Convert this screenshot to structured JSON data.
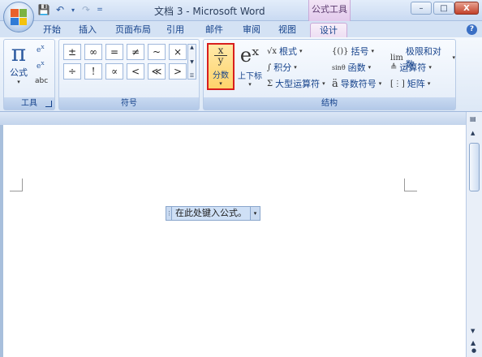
{
  "app": {
    "title": "文档 3 - Microsoft Word",
    "contextual_tab": "公式工具"
  },
  "window_controls": {
    "minimize": "–",
    "restore": "□",
    "close": "X"
  },
  "quick_access": {
    "save": "💾",
    "undo": "↶",
    "undo_arrow": "▾",
    "redo": "↷",
    "customize": "="
  },
  "tabs": [
    {
      "label": "开始"
    },
    {
      "label": "插入"
    },
    {
      "label": "页面布局"
    },
    {
      "label": "引用"
    },
    {
      "label": "邮件"
    },
    {
      "label": "审阅"
    },
    {
      "label": "视图"
    },
    {
      "label": "设计"
    }
  ],
  "help": "?",
  "ribbon": {
    "tools_group": {
      "label": "工具",
      "equation_label": "公式",
      "pi": "π",
      "abc": "abc"
    },
    "symbols_group": {
      "label": "符号",
      "symbols": [
        "±",
        "∞",
        "=",
        "≠",
        "~",
        "×",
        "÷",
        "!",
        "∝",
        "<",
        "≪",
        ">"
      ]
    },
    "structures_group": {
      "label": "结构",
      "fraction_label": "分数",
      "fraction_num": "x",
      "fraction_den": "y",
      "script_label": "上下标",
      "script_icon": "eˣ",
      "radical": "根式",
      "radical_icon": "√x",
      "integral": "积分",
      "integral_icon": "∫",
      "large_operator": "大型运算符",
      "large_operator_icon": "Σ",
      "bracket": "括号",
      "bracket_icon": "{()}",
      "function": "函数",
      "function_icon": "sinθ",
      "accent": "导数符号",
      "accent_icon": "ä",
      "limit_log": "极限和对数",
      "limit_icon": "lim",
      "operator": "运算符",
      "operator_icon": "≜",
      "matrix": "矩阵",
      "matrix_icon": "[⋮]"
    }
  },
  "document": {
    "equation_placeholder": "在此处键入公式。"
  },
  "colors": {
    "ribbon_text": "#15428b",
    "highlight_border": "#d81e1e",
    "contextual": "#e2c9ec"
  }
}
